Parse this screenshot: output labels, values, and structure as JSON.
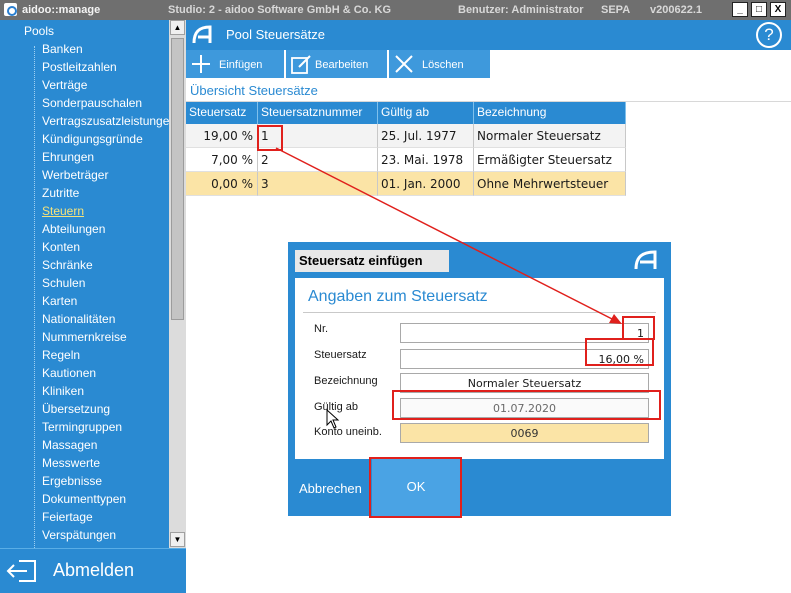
{
  "window": {
    "app_name": "aidoo::manage",
    "studio": "Studio: 2 - aidoo Software GmbH & Co. KG",
    "user": "Benutzer: Administrator",
    "sepa": "SEPA",
    "version": "v200622.1",
    "minimize": "_",
    "restore": "□",
    "close": "X"
  },
  "sidebar": {
    "root": "Pools",
    "items": [
      {
        "label": "Banken"
      },
      {
        "label": "Postleitzahlen"
      },
      {
        "label": "Verträge"
      },
      {
        "label": "Sonderpauschalen"
      },
      {
        "label": "Vertragszusatzleistungen"
      },
      {
        "label": "Kündigungsgründe"
      },
      {
        "label": "Ehrungen"
      },
      {
        "label": "Werbeträger"
      },
      {
        "label": "Zutritte"
      },
      {
        "label": "Steuern",
        "active": true
      },
      {
        "label": "Abteilungen"
      },
      {
        "label": "Konten"
      },
      {
        "label": "Schränke"
      },
      {
        "label": "Schulen"
      },
      {
        "label": "Karten"
      },
      {
        "label": "Nationalitäten"
      },
      {
        "label": "Nummernkreise"
      },
      {
        "label": "Regeln"
      },
      {
        "label": "Kautionen"
      },
      {
        "label": "Kliniken"
      },
      {
        "label": "Übersetzung"
      },
      {
        "label": "Termingruppen"
      },
      {
        "label": "Massagen"
      },
      {
        "label": "Messwerte"
      },
      {
        "label": "Ergebnisse"
      },
      {
        "label": "Dokumenttypen"
      },
      {
        "label": "Feiertage"
      },
      {
        "label": "Verspätungen"
      }
    ],
    "logout_label": "Abmelden"
  },
  "main": {
    "title": "Pool Steuersätze",
    "help": "?",
    "toolbar": {
      "add_label": "Einfügen",
      "edit_label": "Bearbeiten",
      "delete_label": "Löschen"
    },
    "overview_title": "Übersicht Steuersätze",
    "table": {
      "columns": [
        "Steuersatz",
        "Steuersatznummer",
        "Gültig ab",
        "Bezeichnung"
      ],
      "rows": [
        {
          "rate": "19,00 %",
          "number": "1",
          "valid_from": "25. Jul. 1977",
          "name": "Normaler Steuersatz"
        },
        {
          "rate": "7,00 %",
          "number": "2",
          "valid_from": "23. Mai. 1978",
          "name": "Ermäßigter Steuersatz"
        },
        {
          "rate": "0,00 %",
          "number": "3",
          "valid_from": "01. Jan. 2000",
          "name": "Ohne Mehrwertsteuer"
        }
      ]
    }
  },
  "dialog": {
    "title": "Steuersatz einfügen",
    "heading": "Angaben zum Steuersatz",
    "fields": {
      "nr_label": "Nr.",
      "nr_value": "1",
      "rate_label": "Steuersatz",
      "rate_value": "16,00 %",
      "name_label": "Bezeichnung",
      "name_value": "Normaler Steuersatz",
      "valid_label": "Gültig ab",
      "valid_value": "01.07.2020",
      "account_label": "Konto uneinb.",
      "account_value": "0069"
    },
    "cancel_label": "Abbrechen",
    "ok_label": "OK"
  },
  "colors": {
    "accent": "#2a8ad2",
    "selected_row": "#fbe4a6",
    "annotation": "#e0201c",
    "active_nav": "#f6e37a"
  }
}
